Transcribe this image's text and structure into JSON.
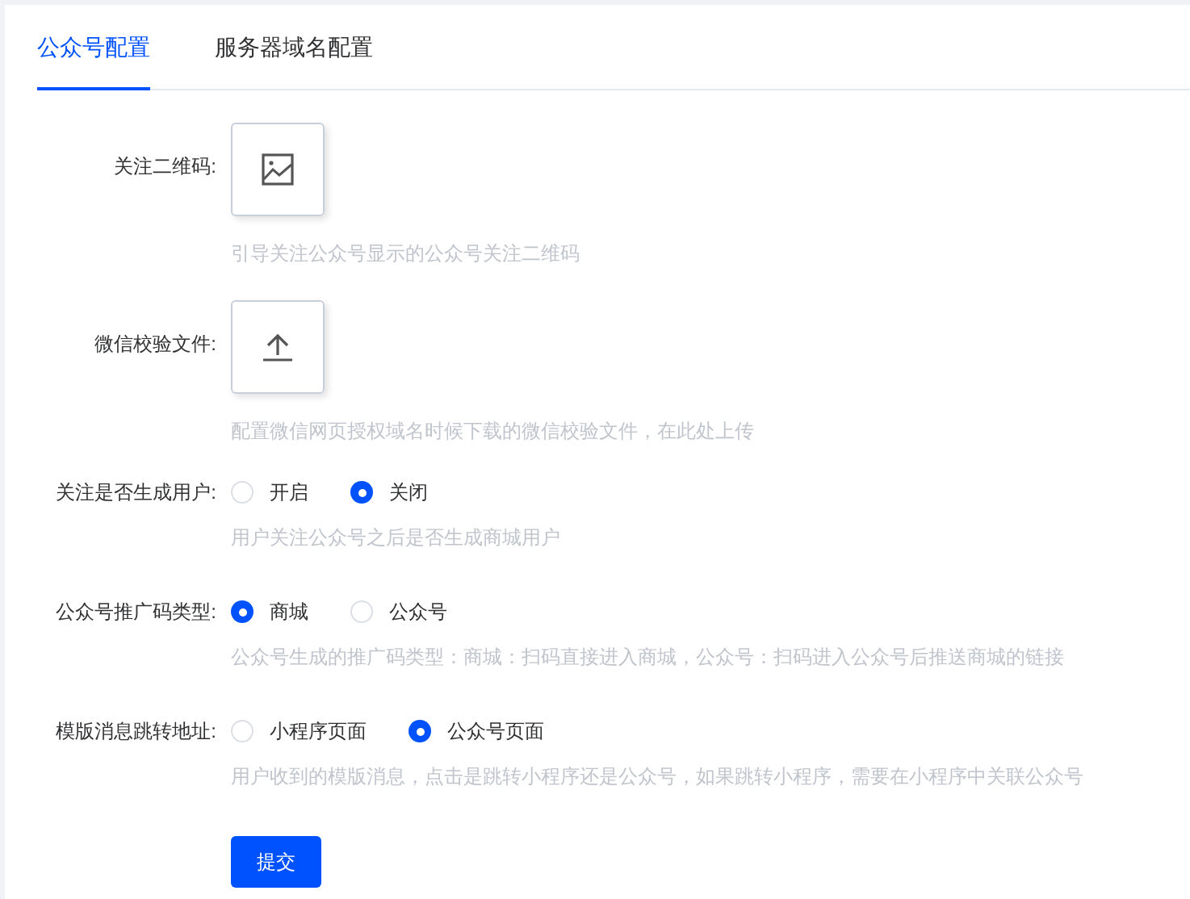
{
  "tabs": [
    {
      "label": "公众号配置",
      "selected": true
    },
    {
      "label": "服务器域名配置",
      "selected": false
    }
  ],
  "form": [
    {
      "kind": "image_upload",
      "label": "关注二维码:",
      "hint": "引导关注公众号显示的公众号关注二维码"
    },
    {
      "kind": "file_upload",
      "label": "微信校验文件:",
      "hint": "配置微信网页授权域名时候下载的微信校验文件，在此处上传"
    },
    {
      "kind": "radio",
      "label": "关注是否生成用户:",
      "options": [
        {
          "label": "开启",
          "selected": false
        },
        {
          "label": "关闭",
          "selected": true
        }
      ],
      "hint": "用户关注公众号之后是否生成商城用户"
    },
    {
      "kind": "radio",
      "label": "公众号推广码类型:",
      "options": [
        {
          "label": "商城",
          "selected": true
        },
        {
          "label": "公众号",
          "selected": false
        }
      ],
      "hint": "公众号生成的推广码类型：商城：扫码直接进入商城，公众号：扫码进入公众号后推送商城的链接"
    },
    {
      "kind": "radio",
      "label": "模版消息跳转地址:",
      "options": [
        {
          "label": "小程序页面",
          "selected": false
        },
        {
          "label": "公众号页面",
          "selected": true
        }
      ],
      "hint": "用户收到的模版消息，点击是跳转小程序还是公众号，如果跳转小程序，需要在小程序中关联公众号"
    }
  ],
  "submit": "提交"
}
